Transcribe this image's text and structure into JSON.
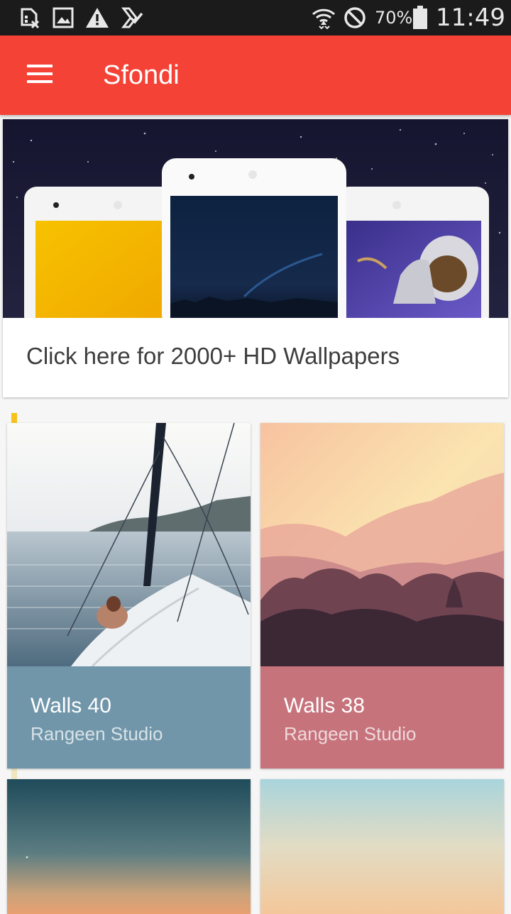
{
  "status_bar": {
    "icons_left": [
      "sim-error-icon",
      "image-icon",
      "warning-icon",
      "checklist-icon"
    ],
    "icons_right": [
      "wifi-icon",
      "do-not-disturb-icon",
      "battery-icon"
    ],
    "battery": "70%",
    "time": "11:49"
  },
  "app_bar": {
    "menu_icon": "menu-icon",
    "title": "Sfondi",
    "color": "#f44336"
  },
  "banner": {
    "text": "Click here for 2000+ HD Wallpapers"
  },
  "wallpapers": [
    {
      "title": "Walls 40",
      "author": "Rangeen Studio",
      "color": "#7196aa"
    },
    {
      "title": "Walls 38",
      "author": "Rangeen Studio",
      "color": "#c6737c"
    },
    {
      "title": "",
      "author": ""
    },
    {
      "title": "",
      "author": ""
    }
  ],
  "scrollbar": {
    "color": "#f7c21a"
  }
}
